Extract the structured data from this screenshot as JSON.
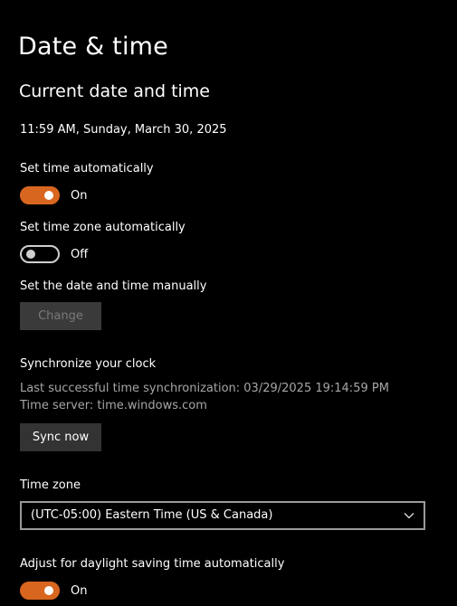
{
  "page": {
    "title": "Date & time"
  },
  "current": {
    "section_title": "Current date and time",
    "datetime": "11:59 AM, Sunday, March 30, 2025"
  },
  "auto_time": {
    "label": "Set time automatically",
    "state": true,
    "state_label": "On"
  },
  "auto_timezone": {
    "label": "Set time zone automatically",
    "state": false,
    "state_label": "Off"
  },
  "manual": {
    "label": "Set the date and time manually",
    "button_label": "Change",
    "button_enabled": false
  },
  "sync": {
    "title": "Synchronize your clock",
    "last_sync": "Last successful time synchronization: 03/29/2025 19:14:59 PM",
    "server": "Time server: time.windows.com",
    "button_label": "Sync now"
  },
  "timezone": {
    "label": "Time zone",
    "selected": "(UTC-05:00) Eastern Time (US & Canada)",
    "icon": "chevron-down-icon"
  },
  "dst": {
    "label": "Adjust for daylight saving time automatically",
    "state": true,
    "state_label": "On"
  },
  "colors": {
    "background": "#000000",
    "accent": "#d9661f",
    "text": "#ffffff",
    "muted_text": "#a6a6a6",
    "disabled_button": "#3a3a3a",
    "button": "#333333"
  }
}
